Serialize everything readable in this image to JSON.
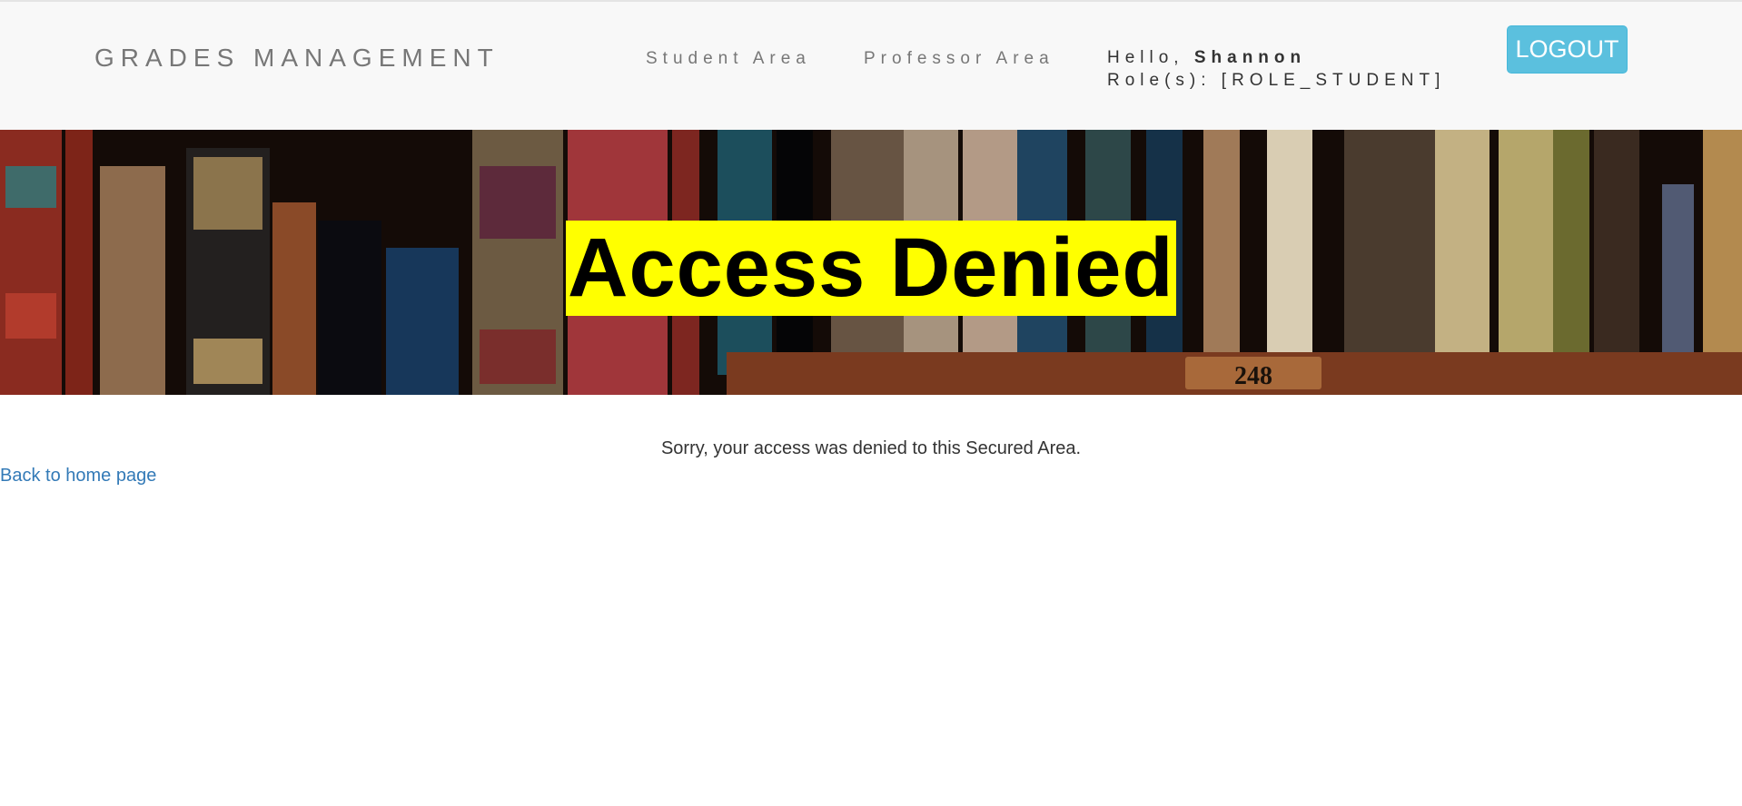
{
  "navbar": {
    "brand": "GRADES MANAGEMENT",
    "links": [
      "Student Area",
      "Professor Area"
    ],
    "greeting_prefix": "Hello,",
    "user_name": "Shannon",
    "roles_line": "Role(s): [ROLE_STUDENT]",
    "logout_label": "LOGOUT"
  },
  "banner": {
    "title": "Access Denied",
    "shelf_number": "248"
  },
  "main": {
    "message": "Sorry, your access was denied to this Secured Area.",
    "back_link": "Back to home page"
  },
  "colors": {
    "navbar_bg": "#f8f8f8",
    "logout_bg": "#5bc0de",
    "title_highlight": "#ffff00",
    "link": "#337ab7"
  }
}
